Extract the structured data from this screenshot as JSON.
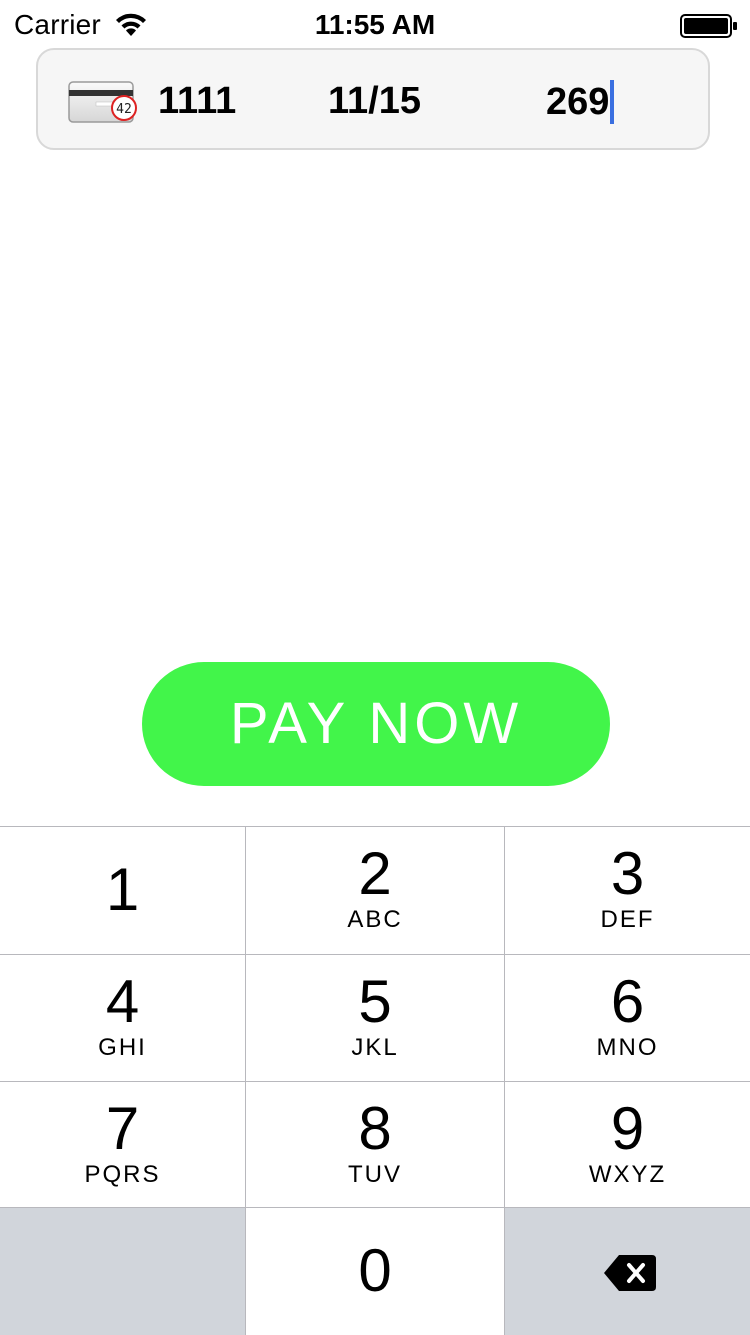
{
  "status_bar": {
    "carrier": "Carrier",
    "time": "11:55 AM"
  },
  "card_field": {
    "number": "1111",
    "expiry": "11/15",
    "cvc": "269",
    "icon": "card-cvc-icon",
    "icon_badge": "42"
  },
  "pay_button": {
    "label": "PAY NOW",
    "color": "#42f54a"
  },
  "keypad": {
    "keys": [
      {
        "digit": "1",
        "letters": ""
      },
      {
        "digit": "2",
        "letters": "ABC"
      },
      {
        "digit": "3",
        "letters": "DEF"
      },
      {
        "digit": "4",
        "letters": "GHI"
      },
      {
        "digit": "5",
        "letters": "JKL"
      },
      {
        "digit": "6",
        "letters": "MNO"
      },
      {
        "digit": "7",
        "letters": "PQRS"
      },
      {
        "digit": "8",
        "letters": "TUV"
      },
      {
        "digit": "9",
        "letters": "WXYZ"
      },
      {
        "digit": "0",
        "letters": ""
      }
    ],
    "delete_icon": "backspace-icon"
  }
}
